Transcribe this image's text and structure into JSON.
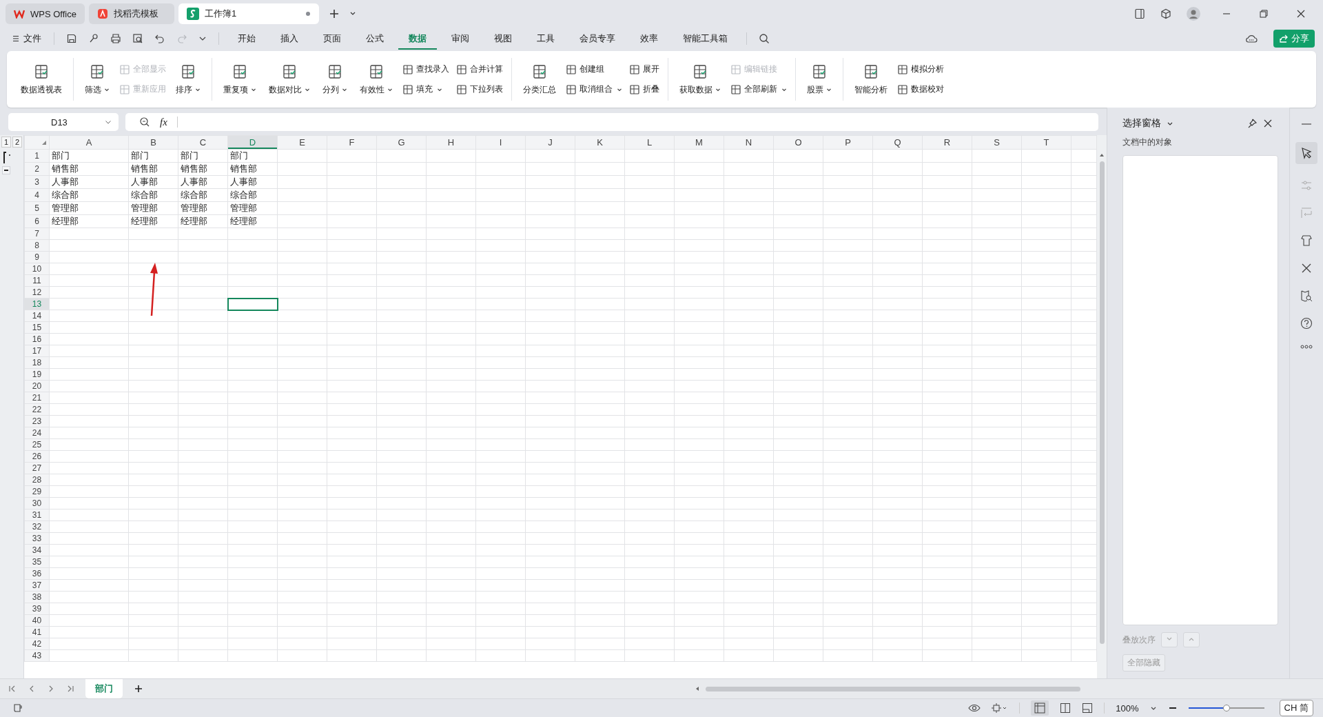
{
  "window_tabs": [
    {
      "kind": "wps",
      "label": "WPS Office",
      "selected": false
    },
    {
      "kind": "template",
      "label": "找稻壳模板",
      "selected": false
    },
    {
      "kind": "sheet",
      "label": "工作簿1",
      "selected": true,
      "unsaved": true
    }
  ],
  "file_menu": "文件",
  "ribbon_tabs": [
    {
      "label": "开始",
      "selected": false
    },
    {
      "label": "插入",
      "selected": false
    },
    {
      "label": "页面",
      "selected": false
    },
    {
      "label": "公式",
      "selected": false
    },
    {
      "label": "数据",
      "selected": true
    },
    {
      "label": "审阅",
      "selected": false
    },
    {
      "label": "视图",
      "selected": false
    },
    {
      "label": "工具",
      "selected": false
    },
    {
      "label": "会员专享",
      "selected": false
    },
    {
      "label": "效率",
      "selected": false
    },
    {
      "label": "智能工具箱",
      "selected": false
    }
  ],
  "share_button": "分享",
  "ribbon_groups": [
    {
      "columns": [
        {
          "kind": "large",
          "label": "数据透视表",
          "dropdown": false
        }
      ]
    },
    {
      "columns": [
        {
          "kind": "large",
          "label": "筛选",
          "dropdown": true
        },
        {
          "kind": "pair",
          "items": [
            {
              "label": "全部显示",
              "disabled": true,
              "dropdown": false
            },
            {
              "label": "重新应用",
              "disabled": true,
              "dropdown": false
            }
          ]
        },
        {
          "kind": "large",
          "label": "排序",
          "dropdown": true
        }
      ]
    },
    {
      "columns": [
        {
          "kind": "large",
          "label": "重复项",
          "dropdown": true
        },
        {
          "kind": "large",
          "label": "数据对比",
          "dropdown": true
        },
        {
          "kind": "large",
          "label": "分列",
          "dropdown": true
        },
        {
          "kind": "large",
          "label": "有效性",
          "dropdown": true
        },
        {
          "kind": "pair",
          "items": [
            {
              "label": "查找录入",
              "disabled": false,
              "dropdown": false
            },
            {
              "label": "填充",
              "disabled": false,
              "dropdown": true
            }
          ]
        },
        {
          "kind": "pair",
          "items": [
            {
              "label": "合并计算",
              "disabled": false,
              "dropdown": false
            },
            {
              "label": "下拉列表",
              "disabled": false,
              "dropdown": false
            }
          ]
        }
      ]
    },
    {
      "columns": [
        {
          "kind": "large",
          "label": "分类汇总",
          "dropdown": false
        },
        {
          "kind": "pair",
          "items": [
            {
              "label": "创建组",
              "disabled": false,
              "dropdown": false
            },
            {
              "label": "取消组合",
              "disabled": false,
              "dropdown": true
            }
          ]
        },
        {
          "kind": "pair",
          "items": [
            {
              "label": "展开",
              "disabled": false,
              "dropdown": false
            },
            {
              "label": "折叠",
              "disabled": false,
              "dropdown": false
            }
          ]
        }
      ]
    },
    {
      "columns": [
        {
          "kind": "large",
          "label": "获取数据",
          "dropdown": true
        },
        {
          "kind": "pair",
          "items": [
            {
              "label": "编辑链接",
              "disabled": true,
              "dropdown": false
            },
            {
              "label": "全部刷新",
              "disabled": false,
              "dropdown": true
            }
          ]
        }
      ]
    },
    {
      "columns": [
        {
          "kind": "large",
          "label": "股票",
          "dropdown": true
        }
      ]
    },
    {
      "columns": [
        {
          "kind": "large",
          "label": "智能分析",
          "dropdown": false
        },
        {
          "kind": "pair",
          "items": [
            {
              "label": "模拟分析",
              "disabled": false,
              "dropdown": false
            },
            {
              "label": "数据校对",
              "disabled": false,
              "dropdown": false
            }
          ]
        }
      ]
    }
  ],
  "name_box": "D13",
  "formula_label": "fx",
  "outline_levels": [
    "1",
    "2"
  ],
  "columns": [
    {
      "label": "A",
      "selected": false
    },
    {
      "label": "B",
      "selected": false
    },
    {
      "label": "C",
      "selected": false
    },
    {
      "label": "D",
      "selected": true
    },
    {
      "label": "E",
      "selected": false
    },
    {
      "label": "F",
      "selected": false
    },
    {
      "label": "G",
      "selected": false
    },
    {
      "label": "H",
      "selected": false
    },
    {
      "label": "I",
      "selected": false
    },
    {
      "label": "J",
      "selected": false
    },
    {
      "label": "K",
      "selected": false
    },
    {
      "label": "L",
      "selected": false
    },
    {
      "label": "M",
      "selected": false
    },
    {
      "label": "N",
      "selected": false
    },
    {
      "label": "O",
      "selected": false
    },
    {
      "label": "P",
      "selected": false
    },
    {
      "label": "Q",
      "selected": false
    },
    {
      "label": "R",
      "selected": false
    },
    {
      "label": "S",
      "selected": false
    },
    {
      "label": "T",
      "selected": false
    }
  ],
  "rows": [
    {
      "number": "1",
      "selected": false,
      "cells": [
        "部门",
        "部门",
        "部门",
        "部门"
      ]
    },
    {
      "number": "2",
      "selected": false,
      "cells": [
        "销售部",
        "销售部",
        "销售部",
        "销售部"
      ]
    },
    {
      "number": "3",
      "selected": false,
      "cells": [
        "人事部",
        "人事部",
        "人事部",
        "人事部"
      ]
    },
    {
      "number": "4",
      "selected": false,
      "cells": [
        "综合部",
        "综合部",
        "综合部",
        "综合部"
      ]
    },
    {
      "number": "5",
      "selected": false,
      "cells": [
        "管理部",
        "管理部",
        "管理部",
        "管理部"
      ]
    },
    {
      "number": "6",
      "selected": false,
      "cells": [
        "经理部",
        "经理部",
        "经理部",
        "经理部"
      ]
    },
    {
      "number": "7",
      "selected": false
    },
    {
      "number": "8",
      "selected": false
    },
    {
      "number": "9",
      "selected": false
    },
    {
      "number": "10",
      "selected": false
    },
    {
      "number": "11",
      "selected": false
    },
    {
      "number": "12",
      "selected": false
    },
    {
      "number": "13",
      "selected": true
    },
    {
      "number": "14",
      "selected": false
    },
    {
      "number": "15",
      "selected": false
    },
    {
      "number": "16",
      "selected": false
    },
    {
      "number": "17",
      "selected": false
    },
    {
      "number": "18",
      "selected": false
    },
    {
      "number": "19",
      "selected": false
    },
    {
      "number": "20",
      "selected": false
    },
    {
      "number": "21",
      "selected": false
    },
    {
      "number": "22",
      "selected": false
    },
    {
      "number": "23",
      "selected": false
    },
    {
      "number": "24",
      "selected": false
    },
    {
      "number": "25",
      "selected": false
    },
    {
      "number": "26",
      "selected": false
    },
    {
      "number": "27",
      "selected": false
    },
    {
      "number": "28",
      "selected": false
    },
    {
      "number": "29",
      "selected": false
    },
    {
      "number": "30",
      "selected": false
    },
    {
      "number": "31",
      "selected": false
    },
    {
      "number": "32",
      "selected": false
    },
    {
      "number": "33",
      "selected": false
    },
    {
      "number": "34",
      "selected": false
    },
    {
      "number": "35",
      "selected": false
    },
    {
      "number": "36",
      "selected": false
    },
    {
      "number": "37",
      "selected": false
    },
    {
      "number": "38",
      "selected": false
    },
    {
      "number": "39",
      "selected": false
    },
    {
      "number": "40",
      "selected": false
    },
    {
      "number": "41",
      "selected": false
    },
    {
      "number": "42",
      "selected": false
    },
    {
      "number": "43",
      "selected": false
    }
  ],
  "sheet_tabs": [
    {
      "label": "部门",
      "selected": true
    }
  ],
  "selection_pane": {
    "title": "选择窗格",
    "subtitle": "文档中的对象",
    "order_label": "叠放次序",
    "hide_all": "全部隐藏"
  },
  "status_bar": {
    "zoom": "100%",
    "zoom_slider": {
      "level": 0.5
    }
  },
  "ime": {
    "mode": "CH",
    "script": "简"
  }
}
